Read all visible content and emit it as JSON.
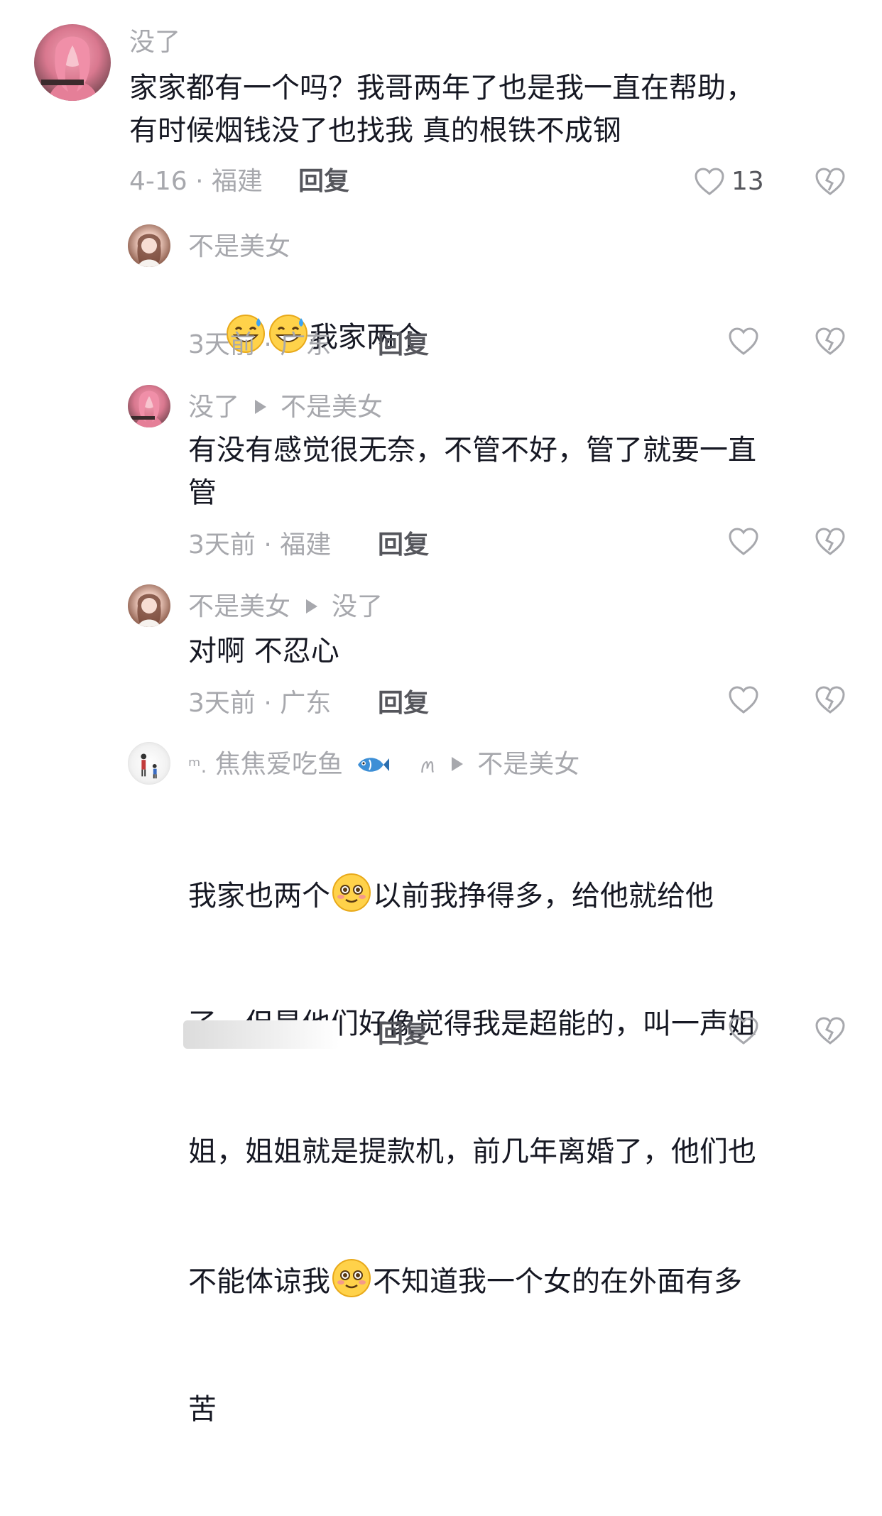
{
  "comments": [
    {
      "user": "没了",
      "reply_to": "",
      "text": "家家都有一个吗？我哥两年了也是我一直在帮助，\n有时候烟钱没了也找我 真的根铁不成钢",
      "meta": "4-16 · 福建",
      "reply_label": "回复",
      "likes": "13"
    },
    {
      "user": "不是美女",
      "reply_to": "",
      "text": "我家两个",
      "meta": "3天前 · 广东",
      "reply_label": "回复",
      "emoji": "grin-sweat-icon"
    },
    {
      "user": "没了",
      "reply_to": "不是美女",
      "text": "有没有感觉很无奈，不管不好，管了就要一直\n管",
      "meta": "3天前 · 福建",
      "reply_label": "回复"
    },
    {
      "user": "不是美女",
      "reply_to": "没了",
      "text": "对啊 不忍心",
      "meta": "3天前 · 广东",
      "reply_label": "回复"
    },
    {
      "user_prefix": "ᵐ.",
      "user": "焦焦爱吃鱼",
      "user_suffix": "ꪔ",
      "reply_to": "不是美女",
      "text_lines": [
        "我家也两个",
        "以前我挣得多，给他就给他",
        "了，但是他们好像觉得我是超能的，叫一声姐",
        "姐，姐姐就是提款机，前几年离婚了，他们也",
        "不能体谅我",
        "不知道我一个女的在外面有多",
        "苦"
      ],
      "reply_label": "回复"
    }
  ],
  "icons": {
    "like": "heart-outline-icon",
    "dislike": "broken-heart-icon",
    "fish": "fish-icon",
    "smile": "smile-blush-icon"
  },
  "colors": {
    "text": "#161823",
    "muted": "#a7a8ad",
    "reply": "#55565c"
  }
}
